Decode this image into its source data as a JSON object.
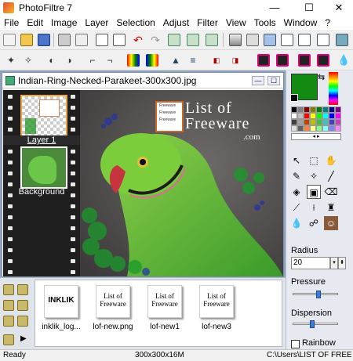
{
  "app": {
    "title": "PhotoFiltre 7"
  },
  "window_controls": {
    "minimize": "—",
    "maximize": "☐",
    "close": "✕"
  },
  "menu": [
    "File",
    "Edit",
    "Image",
    "Layer",
    "Selection",
    "Adjust",
    "Filter",
    "View",
    "Tools",
    "Window",
    "?"
  ],
  "document": {
    "title": "Indian-Ring-Necked-Parakeet-300x300.jpg",
    "minimize": "—",
    "maximize": "☐"
  },
  "layers": [
    {
      "label": "Layer 1",
      "selected": true
    },
    {
      "label": "Background",
      "selected": false
    }
  ],
  "watermark": {
    "line1": "List of",
    "line2": "Freeware",
    "line3": ".com",
    "badge_items": [
      "Freeware",
      "Freeware",
      "Freeware"
    ]
  },
  "files": [
    {
      "name": "inklik_log...",
      "thumb_text": "INKLIK"
    },
    {
      "name": "lof-new.png",
      "thumb_text": "List of Freeware"
    },
    {
      "name": "lof-new1",
      "thumb_text": "List of Freeware"
    },
    {
      "name": "lof-new3",
      "thumb_text": "List of Freeware"
    }
  ],
  "colors": {
    "foreground": "#138b13",
    "background": "#000000"
  },
  "brush": {
    "radius_label": "Radius",
    "radius_value": "20",
    "pressure_label": "Pressure",
    "pressure_level": 0.55,
    "dispersion_label": "Dispersion",
    "dispersion_level": 0.4,
    "rainbow_label": "Rainbow",
    "rainbow_checked": false
  },
  "status": {
    "state": "Ready",
    "dimensions": "300x300x16M",
    "path": "C:\\Users\\LIST OF FREEV"
  }
}
